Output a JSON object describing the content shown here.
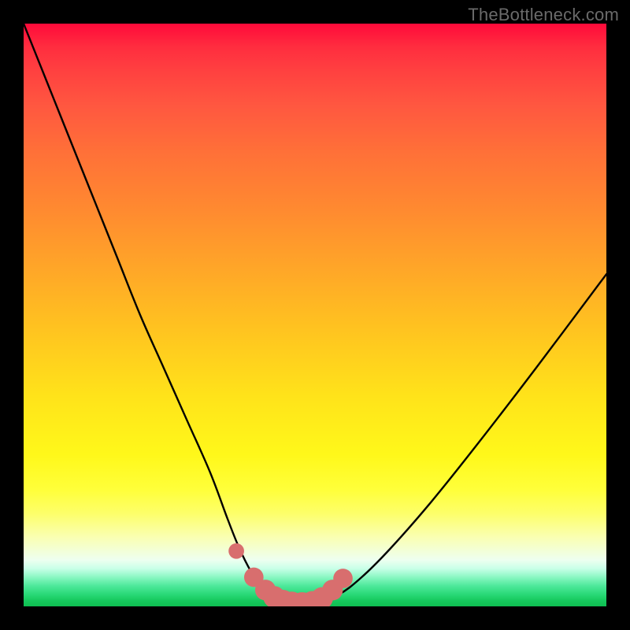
{
  "watermark": "TheBottleneck.com",
  "chart_data": {
    "type": "line",
    "title": "",
    "xlabel": "",
    "ylabel": "",
    "xlim": [
      0,
      100
    ],
    "ylim": [
      0,
      100
    ],
    "series": [
      {
        "name": "bottleneck-curve",
        "x": [
          0,
          4,
          8,
          12,
          16,
          20,
          24,
          28,
          32,
          35,
          37,
          39,
          41,
          44,
          47,
          50,
          54,
          58,
          63,
          70,
          78,
          88,
          100
        ],
        "values": [
          100,
          90,
          80,
          70,
          60,
          50,
          41,
          32,
          23,
          15,
          10,
          6,
          3,
          1,
          0.5,
          0.8,
          2,
          5,
          10,
          18,
          28,
          41,
          57
        ]
      }
    ],
    "markers": {
      "name": "bottom-dots",
      "color": "#d86e6e",
      "points": [
        {
          "x": 36.5,
          "y": 9.5,
          "r": 1.2
        },
        {
          "x": 39.5,
          "y": 5.0,
          "r": 1.8
        },
        {
          "x": 41.5,
          "y": 2.8,
          "r": 2.0
        },
        {
          "x": 43.0,
          "y": 1.6,
          "r": 2.2
        },
        {
          "x": 44.5,
          "y": 0.9,
          "r": 2.3
        },
        {
          "x": 46.0,
          "y": 0.6,
          "r": 2.3
        },
        {
          "x": 47.8,
          "y": 0.5,
          "r": 2.3
        },
        {
          "x": 49.6,
          "y": 0.7,
          "r": 2.3
        },
        {
          "x": 51.2,
          "y": 1.4,
          "r": 2.2
        },
        {
          "x": 53.0,
          "y": 2.8,
          "r": 2.0
        },
        {
          "x": 54.8,
          "y": 4.8,
          "r": 1.8
        }
      ]
    },
    "background_gradient": {
      "top": "#ff0a3a",
      "mid": "#ffe31a",
      "bottom": "#0fbe51"
    }
  }
}
